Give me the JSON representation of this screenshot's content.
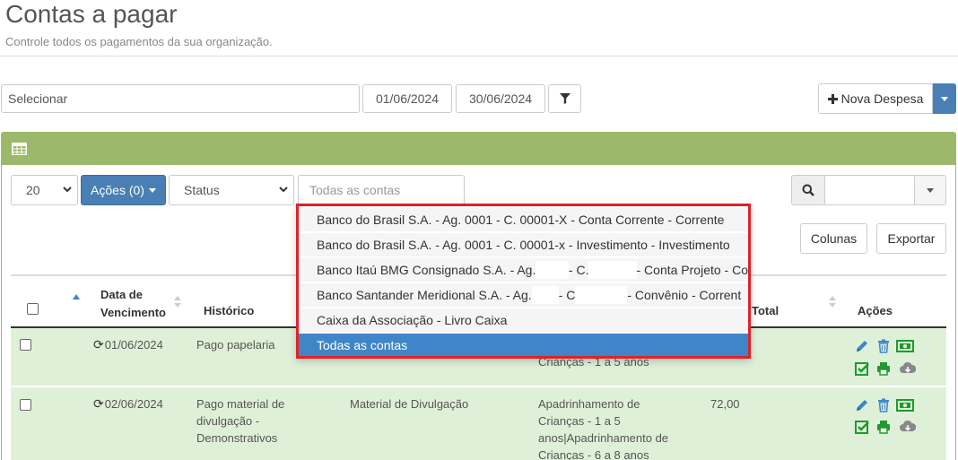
{
  "page": {
    "title": "Contas a pagar",
    "subtitle": "Controle todos os pagamentos da sua organização."
  },
  "filters": {
    "select_placeholder": "Selecionar",
    "date_from": "01/06/2024",
    "date_to": "30/06/2024"
  },
  "nova_despesa": {
    "label": "Nova Despesa"
  },
  "toolbar": {
    "page_size": "20",
    "acoes_label": "Ações (0)",
    "status_label": "Status",
    "contas_placeholder": "Todas as contas",
    "colunas_label": "Colunas",
    "exportar_label": "Exportar"
  },
  "table": {
    "headers": {
      "vencimento": "Data de Vencimento",
      "historico": "Histórico",
      "total": "Total",
      "acoes": "Ações"
    },
    "rows": [
      {
        "date": "01/06/2024",
        "historico": "Pago papelaria",
        "categoria": "",
        "projeto": "Crianças - 1 a 5 anos",
        "valor": ""
      },
      {
        "date": "02/06/2024",
        "historico": "Pago material de divulgação - Demonstrativos",
        "categoria": "Material de Divulgação",
        "projeto": "Apadrinhamento de Crianças - 1 a 5 anos|Apadrinhamento de Crianças - 6 a 8 anos",
        "valor": "72,00"
      }
    ]
  },
  "accounts_dropdown": {
    "items": [
      {
        "text": "Banco do Brasil S.A. - Ag. 0001 - C. 00001-X - Conta Corrente - Corrente"
      },
      {
        "text": "Banco do Brasil S.A. - Ag. 0001 - C. 00001-x - Investimento - Investimento"
      },
      {
        "p1": "Banco Itaú BMG Consignado S.A. - Ag.",
        "p2": "- C.",
        "p3": "- Conta Projeto - Co"
      },
      {
        "p1": "Banco Santander Meridional S.A. - Ag.",
        "p2": "- C",
        "p3": "- Convênio - Corrent"
      },
      {
        "text": "Caixa da Associação - Livro Caixa"
      },
      {
        "text": "Todas as contas"
      }
    ],
    "selected_index": 5
  },
  "colors": {
    "panel_green": "#9cb86a",
    "row_green": "#dff0d8",
    "primary_blue": "#4a7fb5",
    "selected_blue": "#3f86c8",
    "highlight_red": "#e0202a",
    "action_blue": "#3f86c8",
    "action_green": "#1e9a2e",
    "action_gray": "#888888"
  },
  "icons": [
    "filter-icon",
    "plus-icon",
    "grid-icon",
    "search-icon",
    "recurring-icon",
    "edit-icon",
    "trash-icon",
    "money-icon",
    "check-icon",
    "print-icon",
    "download-icon"
  ]
}
